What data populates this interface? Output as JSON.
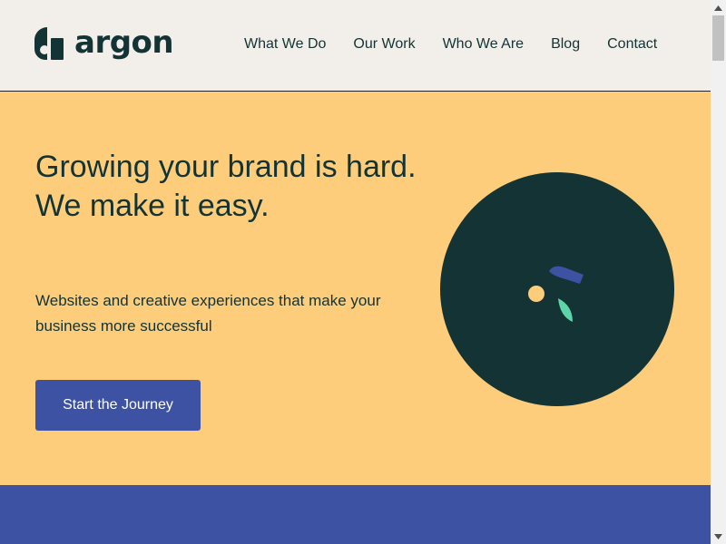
{
  "header": {
    "logo_text": "argon",
    "nav": [
      {
        "label": "What We Do"
      },
      {
        "label": "Our Work"
      },
      {
        "label": "Who We Are"
      },
      {
        "label": "Blog"
      },
      {
        "label": "Contact"
      }
    ]
  },
  "hero": {
    "title_line1": "Growing your brand is hard.",
    "title_line2": "We make it easy.",
    "subtitle": "Websites and creative experiences that make your business more successful",
    "cta_label": "Start the Journey"
  },
  "colors": {
    "brand_dark": "#133334",
    "hero_bg": "#fdcd7b",
    "accent_blue": "#3e52a3",
    "header_bg": "#f2efea",
    "leaf_green": "#5ed4a8"
  },
  "icons": {
    "logo": "argon-logo-mark",
    "scroll_up": "chevron-up-icon",
    "scroll_down": "chevron-down-icon"
  }
}
